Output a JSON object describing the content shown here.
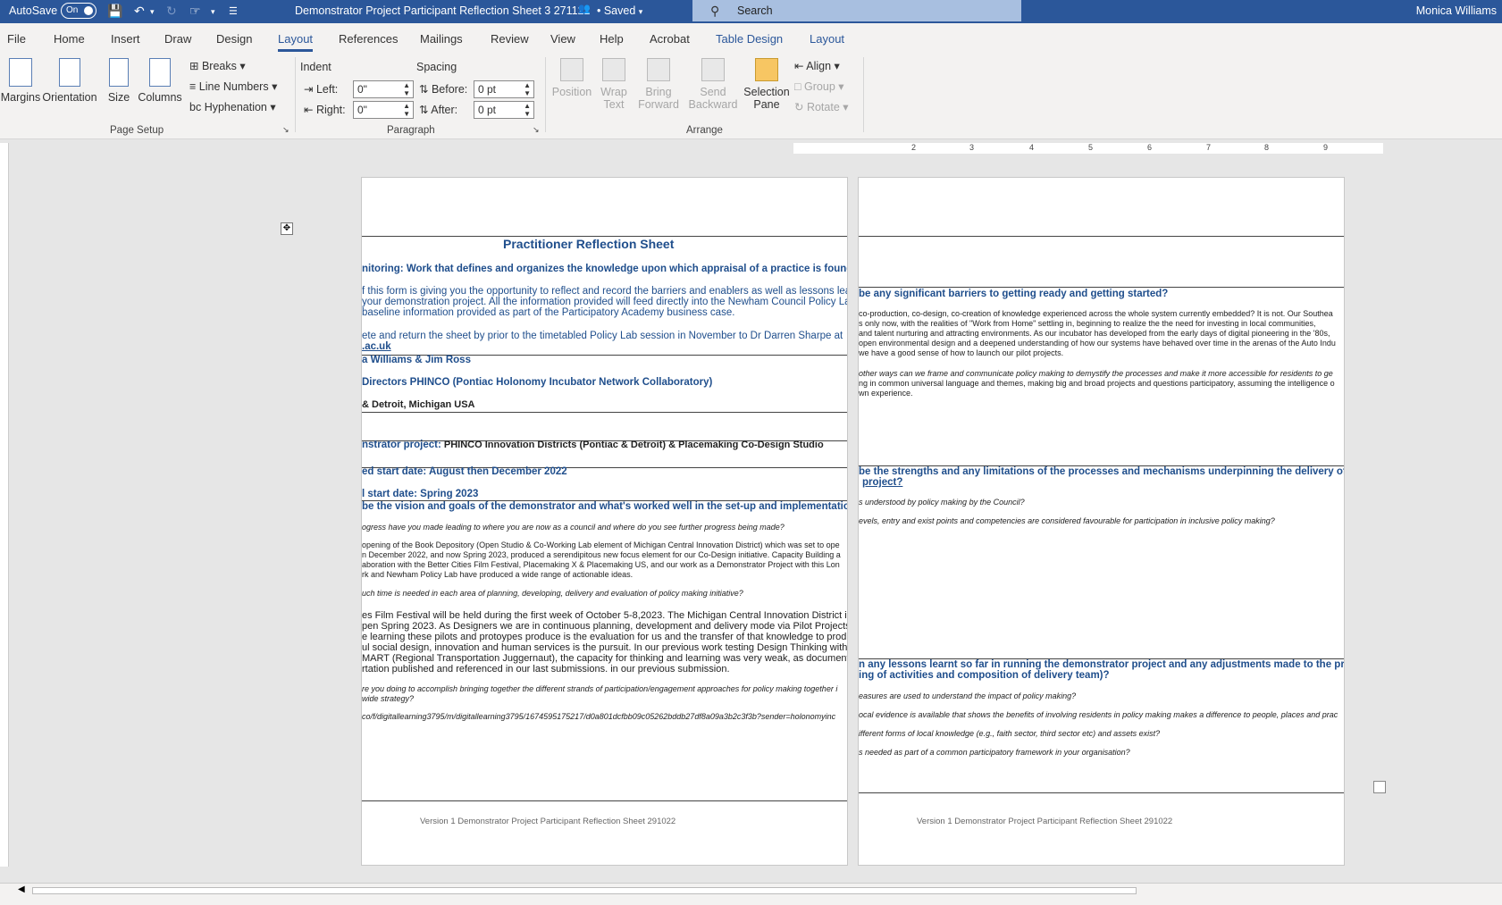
{
  "titlebar": {
    "autosave_label": "AutoSave",
    "toggle": "On",
    "doc_title": "Demonstrator Project Participant Reflection Sheet 3 271122",
    "saved": "• Saved",
    "search_placeholder": "Search",
    "user": "Monica Williams"
  },
  "tabs": [
    "File",
    "Home",
    "Insert",
    "Draw",
    "Design",
    "Layout",
    "References",
    "Mailings",
    "Review",
    "View",
    "Help",
    "Acrobat",
    "Table Design",
    "Layout"
  ],
  "ribbon": {
    "page_setup": {
      "margins": "Margins",
      "orientation": "Orientation",
      "size": "Size",
      "columns": "Columns",
      "breaks": "Breaks",
      "line_numbers": "Line Numbers",
      "hyphenation": "Hyphenation",
      "group": "Page Setup"
    },
    "paragraph": {
      "indent": "Indent",
      "left_label": "Left:",
      "left_value": "0\"",
      "right_label": "Right:",
      "right_value": "0\"",
      "spacing": "Spacing",
      "before_label": "Before:",
      "before_value": "0 pt",
      "after_label": "After:",
      "after_value": "0 pt",
      "group": "Paragraph"
    },
    "arrange": {
      "position": "Position",
      "wrap_text": "Wrap Text",
      "bring_forward": "Bring Forward",
      "send_backward": "Send Backward",
      "selection_pane": "Selection Pane",
      "align": "Align",
      "group_btn": "Group",
      "rotate": "Rotate",
      "group": "Arrange"
    }
  },
  "ruler": {
    "numbers": [
      "2",
      "3",
      "4",
      "5",
      "6",
      "7",
      "8",
      "9"
    ]
  },
  "page1": {
    "title": "Practitioner Reflection Sheet",
    "l1": "nitoring: Work that defines and organizes the knowledge upon which appraisal of a practice is founded",
    "l2": "f this form is giving you the opportunity to reflect and record the barriers and enablers as well as lessons learnt i",
    "l3": "your demonstration project. All the information provided will feed directly into the Newham Council Policy Lab an",
    "l4": "baseline information provided as part of the Participatory Academy business case.",
    "l5": "ete and return the sheet by prior to the timetabled Policy Lab session in November to Dr Darren Sharpe at",
    "l6": ".ac.uk",
    "l7": "a Williams & Jim Ross",
    "l8": "Directors PHINCO (Pontiac Holonomy Incubator Network Collaboratory)",
    "l9": "& Detroit, Michigan USA",
    "l10a": "nstrator project:",
    "l10b": "PHINCO Innovation Districts (Pontiac & Detroit) & Placemaking Co-Design Studio",
    "l11": "ed start date: August then December 2022",
    "l12": "l start date: Spring 2023",
    "l13": "be the vision and goals of the demonstrator and what's worked well in the set-up and implementation?",
    "q1": "ogress have you made leading to where you are now as a council and where do you see further progress being made?",
    "a1": [
      "opening of the Book Depository (Open Studio & Co-Working Lab element of Michigan Central Innovation District) which was set to ope",
      "n December 2022, and now Spring 2023, produced a serendipitous new focus element for our Co-Design initiative. Capacity Building a",
      "aboration with the Better Cities Film Festival, Placemaking X & Placemaking US, and our work as a Demonstrator Project with this Lon",
      "rk and Newham Policy Lab have produced a wide range of actionable ideas."
    ],
    "q2": "uch time is needed in each area of planning, developing, delivery and evaluation of policy making initiative?",
    "a2": [
      "es Film Festival will be held during the first week of October 5-8,2023. The Michigan Central Innovation District i",
      "pen Spring 2023. As Designers we are in continuous planning, development and delivery mode via Pilot Projects",
      "e learning these pilots and protoypes produce is the evaluation for us and the transfer of that knowledge to prod",
      "ul social design, innovation and human services is the pursuit. In our previous work testing Design Thinking with",
      "MART (Regional Transportation Juggernaut), the capacity for thinking and learning was very weak, as document",
      "rtation published and referenced in our last submissions.  in our previous submission."
    ],
    "q3": [
      "re you doing to accomplish bringing together the different strands of participation/engagement approaches for policy making together i",
      "wide strategy?"
    ],
    "link": "co/f/digitallearning3795/m/digitallearning3795/1674595175217/d0a801dcfbb09c05262bddb27df8a09a3b2c3f3b?sender=holonomyinc",
    "footer": "Version 1 Demonstrator Project Participant Reflection Sheet 291022"
  },
  "page2": {
    "h1": "be any significant barriers to getting ready and getting started?",
    "p1": [
      "co-production, co-design, co-creation of knowledge experienced across the whole system currently embedded? It is not. Our Southea",
      "s only now, with the realities of \"Work from Home\" settling in, beginning to realize the the need for investing in local communities,",
      "and talent nurturing and attracting environments. As our incubator has developed from the early days of digital pioneering in the '80s,",
      "open environmental design and a deepened understanding of how our systems have behaved over time in the arenas of the Auto Indu",
      "we have a good sense of how to launch our pilot projects."
    ],
    "p2": [
      "other ways can we frame and communicate policy making to demystify the processes and make it more accessible for residents to ge",
      "ng in common universal language and themes, making big and broad projects and questions participatory, assuming the intelligence o",
      "wn experience."
    ],
    "h2a": "be the strengths and any limitations of the processes and mechanisms underpinning the delivery of the",
    "h2b": "project?",
    "q1": "s understood by policy making by the Council?",
    "q2": "evels, entry and exist points and competencies are considered favourable for participation in inclusive policy making?",
    "h3a": "n any lessons learnt so far in running the demonstrator project and any adjustments made to the project",
    "h3b": "ing of activities and composition of delivery team)?",
    "q3": "easures are used to understand the impact of policy making?",
    "q4": "ocal evidence is available that shows the benefits of involving residents in policy making makes a difference to people, places and prac",
    "q5": "ifferent forms of local knowledge (e.g., faith sector, third sector etc) and assets exist?",
    "q6": "s needed as part of a common participatory framework in your organisation?",
    "footer": "Version 1 Demonstrator Project Participant Reflection Sheet 291022"
  }
}
